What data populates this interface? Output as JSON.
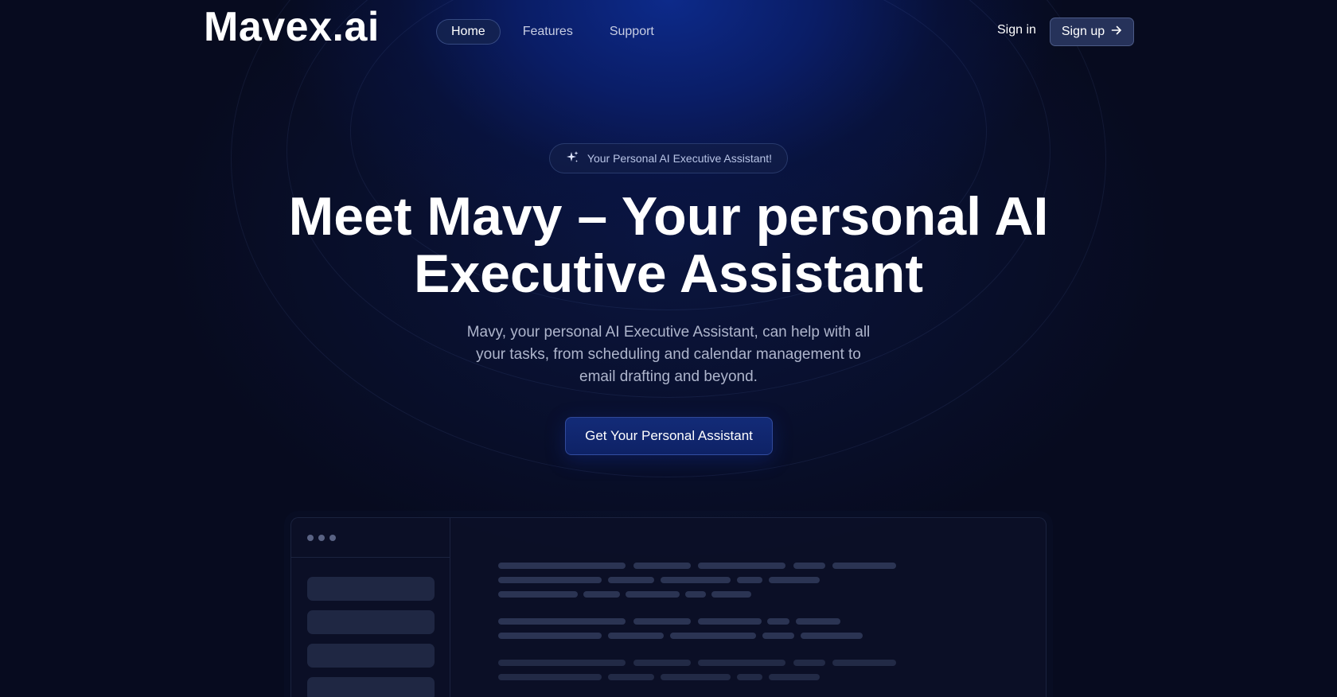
{
  "brand": {
    "logo": "Mavex.ai"
  },
  "nav": {
    "links": [
      {
        "label": "Home",
        "active": true
      },
      {
        "label": "Features",
        "active": false
      },
      {
        "label": "Support",
        "active": false
      }
    ],
    "signin_label": "Sign in",
    "signup_label": "Sign up"
  },
  "hero": {
    "badge": "Your Personal AI Executive Assistant!",
    "headline_line1": "Meet Mavy – Your personal AI",
    "headline_line2": "Executive Assistant",
    "subtext": "Mavy, your personal AI Executive Assistant, can help with all your tasks, from scheduling and calendar management to email drafting and beyond.",
    "cta_label": "Get Your Personal Assistant"
  },
  "colors": {
    "background": "#070b1f",
    "accent_glow": "#0d2a8a",
    "cta": "#132b78",
    "signup_button": "#26325a"
  },
  "icons": {
    "badge_icon": "sparkle-icon",
    "signup_icon": "arrow-right-icon"
  }
}
